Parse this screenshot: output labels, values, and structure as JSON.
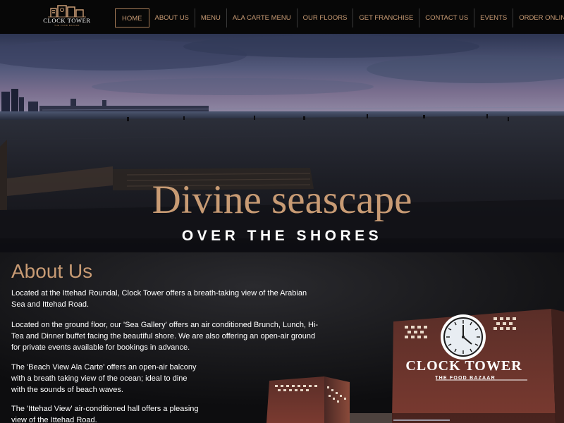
{
  "brand": {
    "name": "CLOCK TOWER",
    "tagline": "THE FOOD BAZAAR"
  },
  "nav": {
    "items": [
      {
        "label": "HOME"
      },
      {
        "label": "ABOUT US"
      },
      {
        "label": "MENU"
      },
      {
        "label": "ALA CARTE MENU"
      },
      {
        "label": "OUR FLOORS"
      },
      {
        "label": "GET FRANCHISE"
      },
      {
        "label": "CONTACT US"
      },
      {
        "label": "EVENTS"
      },
      {
        "label": "ORDER ONLINE"
      }
    ]
  },
  "hero": {
    "title": "Divine seascape",
    "subtitle": "OVER THE SHORES"
  },
  "about": {
    "title": "About Us",
    "paragraphs": [
      "Located at the Ittehad Roundal, Clock Tower offers a breath-taking view of the Arabian Sea and Ittehad Road.",
      "Located on the ground floor, our 'Sea Gallery' offers an air conditioned Brunch, Lunch, Hi-Tea and Dinner buffet facing the beautiful shore. We are also offering an open-air ground for private events available for bookings in advance.",
      "The 'Beach View Ala Carte' offers an open-air balcony with a breath taking view of the ocean; ideal to dine with the sounds of beach waves.",
      "The 'Ittehad View' air-conditioned hall offers a pleasing view of the Ittehad Road."
    ]
  },
  "signage": {
    "main": "CLOCK TOWER",
    "sub": "THE FOOD BAZAAR"
  },
  "colors": {
    "accent": "#c89b74",
    "nav_bg": "#070707",
    "text": "#ffffff"
  }
}
